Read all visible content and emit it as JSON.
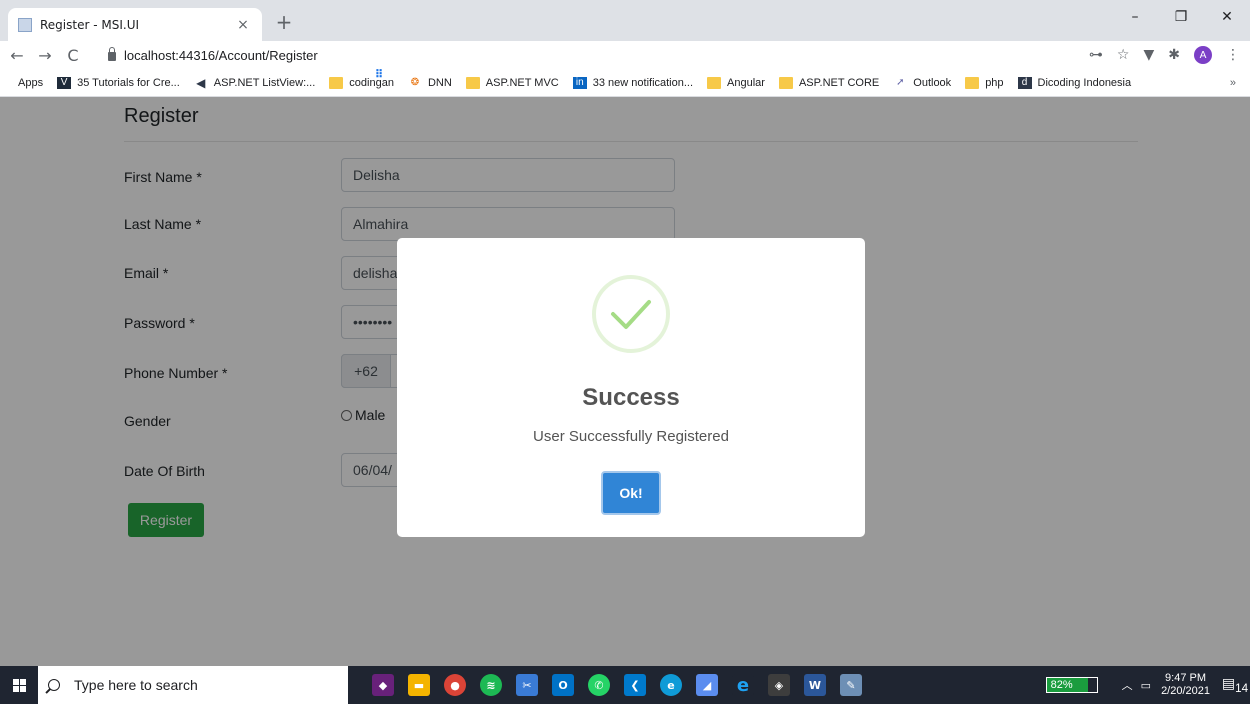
{
  "browser": {
    "tab_title": "Register - MSI.UI",
    "tab_close": "×",
    "new_tab": "+",
    "window_controls": {
      "minimize": "–",
      "restore": "❐",
      "close": "✕"
    },
    "nav": {
      "back": "←",
      "forward": "→",
      "reload": "C"
    },
    "url": "localhost:44316/Account/Register",
    "avatar_letter": "A",
    "toolbar_icons": {
      "key": "⊶",
      "star": "☆",
      "filter": "▼",
      "puzzle": "✱",
      "menu": "⋮"
    },
    "bookmarks": [
      {
        "label": "Apps",
        "icon": "apps-icon"
      },
      {
        "label": "35 Tutorials for Cre...",
        "icon": "v-icon"
      },
      {
        "label": "ASP.NET ListView:...",
        "icon": "pen-icon"
      },
      {
        "label": "codingan",
        "icon": "folder-icon"
      },
      {
        "label": "DNN",
        "icon": "dnn-icon"
      },
      {
        "label": "ASP.NET MVC",
        "icon": "folder-icon"
      },
      {
        "label": "33 new notification...",
        "icon": "linkedin-icon"
      },
      {
        "label": "Angular",
        "icon": "folder-icon"
      },
      {
        "label": "ASP.NET CORE",
        "icon": "folder-icon"
      },
      {
        "label": "Outlook",
        "icon": "teams-icon"
      },
      {
        "label": "php",
        "icon": "folder-icon"
      },
      {
        "label": "Dicoding Indonesia",
        "icon": "dicoding-icon"
      }
    ],
    "bookmarks_more": "»"
  },
  "form": {
    "heading": "Register",
    "fields": {
      "first_name": {
        "label": "First Name *",
        "value": "Delisha"
      },
      "last_name": {
        "label": "Last Name *",
        "value": "Almahira"
      },
      "email": {
        "label": "Email *",
        "value": "delisha"
      },
      "password": {
        "label": "Password *",
        "value": "••••••••"
      },
      "phone": {
        "label": "Phone Number *",
        "prefix": "+62",
        "value": ""
      },
      "gender": {
        "label": "Gender",
        "option_male": "Male"
      },
      "dob": {
        "label": "Date Of Birth",
        "value": "06/04/"
      }
    },
    "submit_label": "Register"
  },
  "modal": {
    "title": "Success",
    "message": "User Successfully Registered",
    "ok_label": "Ok!",
    "accent": "#3085d6",
    "check_color": "#a5dc86"
  },
  "taskbar": {
    "search_placeholder": "Type here to search",
    "apps": [
      "visual-studio-icon",
      "file-explorer-icon",
      "chrome-icon",
      "spotify-icon",
      "snip-icon",
      "outlook-icon",
      "whatsapp-icon",
      "vscode-icon",
      "edge-icon",
      "app-icon",
      "ie-icon",
      "git-icon",
      "word-icon",
      "paint-icon"
    ],
    "battery": "82%",
    "time": "9:47 PM",
    "date": "2/20/2021",
    "notification_count": "14"
  }
}
